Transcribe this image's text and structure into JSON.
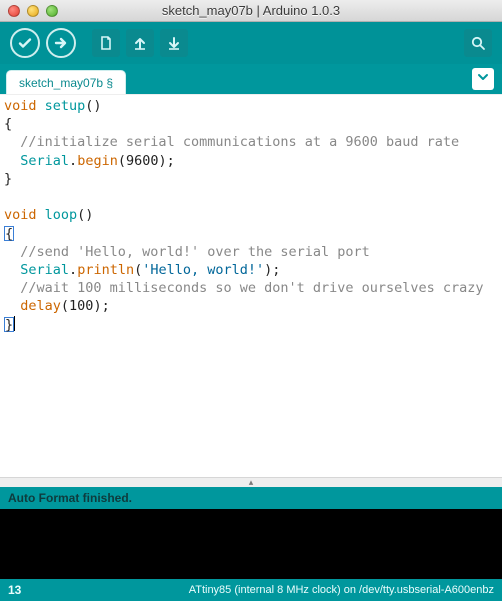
{
  "window": {
    "title": "sketch_may07b | Arduino 1.0.3"
  },
  "toolbar": {
    "verify_tip": "Verify",
    "upload_tip": "Upload",
    "new_tip": "New",
    "open_tip": "Open",
    "save_tip": "Save",
    "serial_tip": "Serial Monitor"
  },
  "tabs": {
    "items": [
      {
        "label": "sketch_may07b §"
      }
    ],
    "menu_tip": "Tab menu"
  },
  "code": {
    "l1_kw": "void",
    "l1_fn": "setup",
    "l3_cmt": "//initialize serial communications at a 9600 baud rate",
    "l4_obj": "Serial",
    "l4_fn": "begin",
    "l4_arg": "9600",
    "l7_kw": "void",
    "l7_fn": "loop",
    "l9_cmt": "//send 'Hello, world!' over the serial port",
    "l10_obj": "Serial",
    "l10_fn": "println",
    "l10_str": "'Hello, world!'",
    "l11_cmt": "//wait 100 milliseconds so we don't drive ourselves crazy",
    "l12_fn": "delay",
    "l12_arg": "100",
    "brace_open": "{",
    "brace_close": "}",
    "paren_open": "(",
    "paren_close": ")",
    "semi": ";",
    "dot": "."
  },
  "status": {
    "message": "Auto Format finished."
  },
  "footer": {
    "line": "13",
    "board": "ATtiny85 (internal 8 MHz clock) on /dev/tty.usbserial-A600enbz"
  }
}
